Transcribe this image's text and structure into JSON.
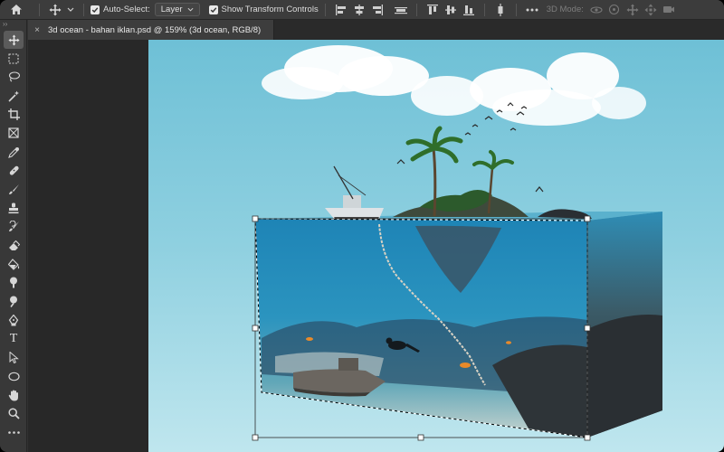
{
  "options_bar": {
    "auto_select_label": "Auto-Select:",
    "auto_select_checked": true,
    "auto_select_target": "Layer",
    "show_transform_label": "Show Transform Controls",
    "show_transform_checked": true,
    "mode_3d_label": "3D Mode:"
  },
  "tools_panel": {
    "collapse_glyph": "››",
    "text_tool_glyph": "T",
    "tools": [
      {
        "name": "move-tool",
        "icon": "move-icon",
        "active": true
      },
      {
        "name": "marquee-tool",
        "icon": "marquee-icon"
      },
      {
        "name": "lasso-tool",
        "icon": "lasso-icon"
      },
      {
        "name": "magic-wand-tool",
        "icon": "magic-wand-icon"
      },
      {
        "name": "crop-tool",
        "icon": "crop-icon"
      },
      {
        "name": "frame-tool",
        "icon": "frame-icon"
      },
      {
        "name": "eyedropper-tool",
        "icon": "eyedropper-icon"
      },
      {
        "name": "healing-brush-tool",
        "icon": "bandage-icon"
      },
      {
        "name": "brush-tool",
        "icon": "brush-icon"
      },
      {
        "name": "clone-stamp-tool",
        "icon": "stamp-icon"
      },
      {
        "name": "history-brush-tool",
        "icon": "history-brush-icon"
      },
      {
        "name": "eraser-tool",
        "icon": "eraser-icon"
      },
      {
        "name": "paint-bucket-tool",
        "icon": "paint-bucket-icon"
      },
      {
        "name": "smudge-tool",
        "icon": "smudge-icon"
      },
      {
        "name": "dodge-tool",
        "icon": "dodge-icon"
      },
      {
        "name": "pen-tool",
        "icon": "pen-icon"
      },
      {
        "name": "type-tool",
        "icon": "type-icon"
      },
      {
        "name": "path-selection-tool",
        "icon": "arrow-icon"
      },
      {
        "name": "ellipse-tool",
        "icon": "ellipse-icon"
      },
      {
        "name": "hand-tool",
        "icon": "hand-icon"
      },
      {
        "name": "zoom-tool",
        "icon": "zoom-icon"
      },
      {
        "name": "more-tools",
        "icon": "ellipsis-icon"
      }
    ]
  },
  "document_tab": {
    "close_glyph": "×",
    "title": "3d ocean - bahan iklan.psd @ 159% (3d ocean, RGB/8)"
  },
  "colors": {
    "options_bar_bg": "#3c3c3c",
    "panel_bg": "#383838",
    "canvas_bg": "#282828",
    "sky_top": "#6fc3d8",
    "water": "#2f8fb4",
    "rock": "#3a4046"
  }
}
